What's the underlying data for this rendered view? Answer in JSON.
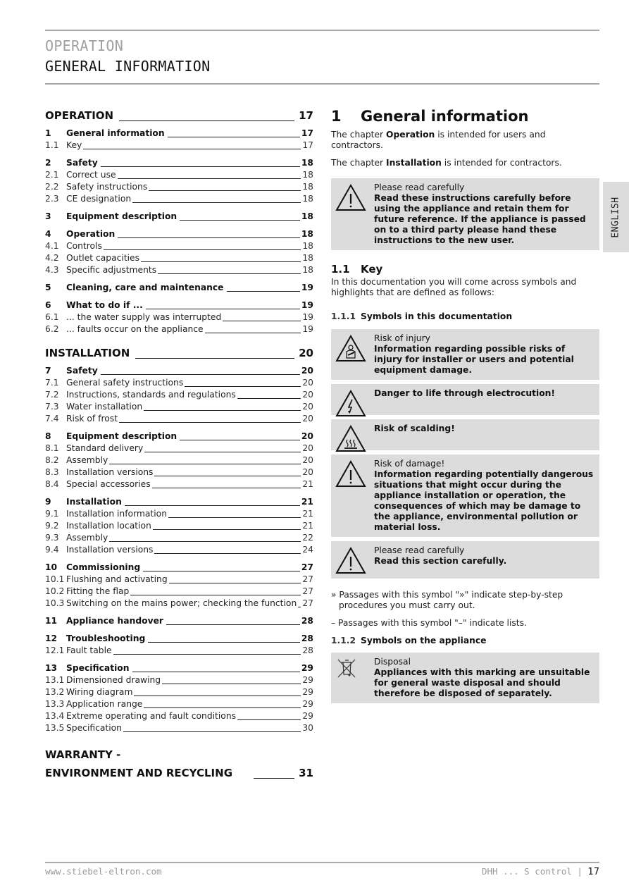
{
  "header": {
    "section": "OPERATION",
    "title": "GENERAL INFORMATION"
  },
  "side_tab": "ENGLISH",
  "toc": {
    "operation": {
      "label": "OPERATION",
      "page": "17"
    },
    "groups_operation": [
      {
        "num": "1",
        "label": "General information",
        "page": "17",
        "subs": [
          {
            "num": "1.1",
            "label": "Key",
            "page": "17"
          }
        ]
      },
      {
        "num": "2",
        "label": "Safety",
        "page": "18",
        "subs": [
          {
            "num": "2.1",
            "label": "Correct use",
            "page": "18"
          },
          {
            "num": "2.2",
            "label": "Safety instructions",
            "page": "18"
          },
          {
            "num": "2.3",
            "label": "CE designation",
            "page": "18"
          }
        ]
      },
      {
        "num": "3",
        "label": "Equipment description",
        "page": "18",
        "subs": []
      },
      {
        "num": "4",
        "label": "Operation",
        "page": "18",
        "subs": [
          {
            "num": "4.1",
            "label": "Controls",
            "page": "18"
          },
          {
            "num": "4.2",
            "label": "Outlet capacities",
            "page": "18"
          },
          {
            "num": "4.3",
            "label": "Specific adjustments",
            "page": "18"
          }
        ]
      },
      {
        "num": "5",
        "label": "Cleaning, care and maintenance",
        "page": "19",
        "subs": []
      },
      {
        "num": "6",
        "label": "What to do if ...",
        "page": "19",
        "subs": [
          {
            "num": "6.1",
            "label": "... the water supply was interrupted",
            "page": "19"
          },
          {
            "num": "6.2",
            "label": "... faults occur on the appliance",
            "page": "19"
          }
        ]
      }
    ],
    "installation": {
      "label": "INSTALLATION",
      "page": "20"
    },
    "groups_installation": [
      {
        "num": "7",
        "label": "Safety",
        "page": "20",
        "subs": [
          {
            "num": "7.1",
            "label": "General safety instructions",
            "page": "20"
          },
          {
            "num": "7.2",
            "label": "Instructions, standards and regulations",
            "page": "20"
          },
          {
            "num": "7.3",
            "label": "Water installation",
            "page": "20"
          },
          {
            "num": "7.4",
            "label": "Risk of frost",
            "page": "20"
          }
        ]
      },
      {
        "num": "8",
        "label": "Equipment description",
        "page": "20",
        "subs": [
          {
            "num": "8.1",
            "label": "Standard delivery",
            "page": "20"
          },
          {
            "num": "8.2",
            "label": "Assembly",
            "page": "20"
          },
          {
            "num": "8.3",
            "label": "Installation versions",
            "page": "20"
          },
          {
            "num": "8.4",
            "label": "Special accessories",
            "page": "21"
          }
        ]
      },
      {
        "num": "9",
        "label": "Installation",
        "page": "21",
        "subs": [
          {
            "num": "9.1",
            "label": "Installation information",
            "page": "21"
          },
          {
            "num": "9.2",
            "label": "Installation location",
            "page": "21"
          },
          {
            "num": "9.3",
            "label": "Assembly",
            "page": "22"
          },
          {
            "num": "9.4",
            "label": "Installation versions",
            "page": "24"
          }
        ]
      },
      {
        "num": "10",
        "label": "Commissioning",
        "page": "27",
        "subs": [
          {
            "num": "10.1",
            "label": "Flushing and activating",
            "page": "27"
          },
          {
            "num": "10.2",
            "label": "Fitting the flap",
            "page": "27"
          },
          {
            "num": "10.3",
            "label": "Switching on the mains power; checking the function",
            "page": "27"
          }
        ]
      },
      {
        "num": "11",
        "label": "Appliance handover",
        "page": "28",
        "subs": []
      },
      {
        "num": "12",
        "label": "Troubleshooting",
        "page": "28",
        "subs": [
          {
            "num": "12.1",
            "label": "Fault table",
            "page": "28"
          }
        ]
      },
      {
        "num": "13",
        "label": "Specification",
        "page": "29",
        "subs": [
          {
            "num": "13.1",
            "label": "Dimensioned drawing",
            "page": "29"
          },
          {
            "num": "13.2",
            "label": "Wiring diagram",
            "page": "29"
          },
          {
            "num": "13.3",
            "label": "Application range",
            "page": "29"
          },
          {
            "num": "13.4",
            "label": "Extreme operating and fault conditions",
            "page": "29"
          },
          {
            "num": "13.5",
            "label": "Specification",
            "page": "30"
          }
        ]
      }
    ],
    "warranty": {
      "line1": "WARRANTY -",
      "line2": "ENVIRONMENT AND RECYCLING",
      "page": "31"
    }
  },
  "content": {
    "h1_num": "1",
    "h1_title": "General information",
    "p1_pre": "The chapter ",
    "p1_bold": "Operation",
    "p1_post": " is intended for users and contractors.",
    "p2_pre": "The chapter ",
    "p2_bold": "Installation",
    "p2_post": " is intended for contractors.",
    "notice1": {
      "icon": "warning-icon",
      "title": "Please read carefully",
      "body": "Read these instructions carefully before using the appliance and retain them for future reference. If the appliance is passed on to a third party please hand these instructions to the new user."
    },
    "h2_num": "1.1",
    "h2_title": "Key",
    "key_intro": "In this documentation you will come across symbols and highlights that are defined as follows:",
    "h3a_num": "1.1.1",
    "h3a_title": "Symbols in this documentation",
    "symbols": [
      {
        "icon": "injury-warning-icon",
        "title": "Risk of injury",
        "body": "Information regarding possible risks of injury for installer or users and potential equipment damage."
      },
      {
        "icon": "electrocution-warning-icon",
        "title": "",
        "body": "Danger to life through electrocution!"
      },
      {
        "icon": "scalding-warning-icon",
        "title": "",
        "body": "Risk of scalding!"
      },
      {
        "icon": "damage-warning-icon",
        "title": "Risk of damage!",
        "body": "Information regarding potentially dangerous situations that might occur during the appliance installation or operation, the consequences of which may be damage to the appliance, environmental pollution or material loss."
      },
      {
        "icon": "warning-icon",
        "title": "Please read carefully",
        "body": "Read this section carefully."
      }
    ],
    "step_text": "» Passages with this symbol \"»\" indicate step-by-step procedures you must carry out.",
    "list_text": "– Passages with this symbol \"–\" indicate lists.",
    "h3b_num": "1.1.2",
    "h3b_title": "Symbols on the appliance",
    "disposal": {
      "icon": "disposal-bin-icon",
      "title": "Disposal",
      "body": "Appliances with this marking are unsuitable for general waste disposal and should therefore be disposed of separately."
    }
  },
  "footer": {
    "website": "www.stiebel-eltron.com",
    "model": "DHH ... S control | ",
    "page": "17"
  }
}
